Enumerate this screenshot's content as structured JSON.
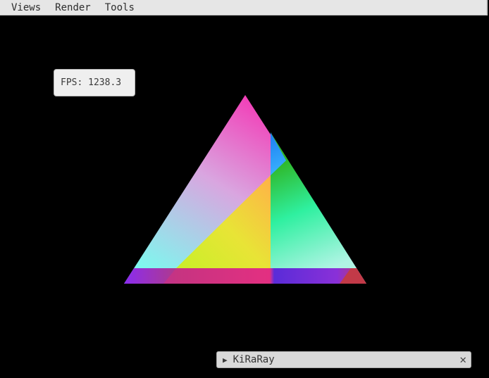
{
  "menu": {
    "items": [
      "Views",
      "Render",
      "Tools"
    ]
  },
  "overlay": {
    "fps_text": "FPS: 1238.3"
  },
  "panel": {
    "toggle_icon": "play-icon",
    "title": "KiRaRay",
    "close_icon": "close-icon",
    "close_glyph": "✕",
    "toggle_glyph": "▶"
  },
  "colors": {
    "menubar_bg": "#e6e6e6",
    "viewport_bg": "#000000"
  }
}
